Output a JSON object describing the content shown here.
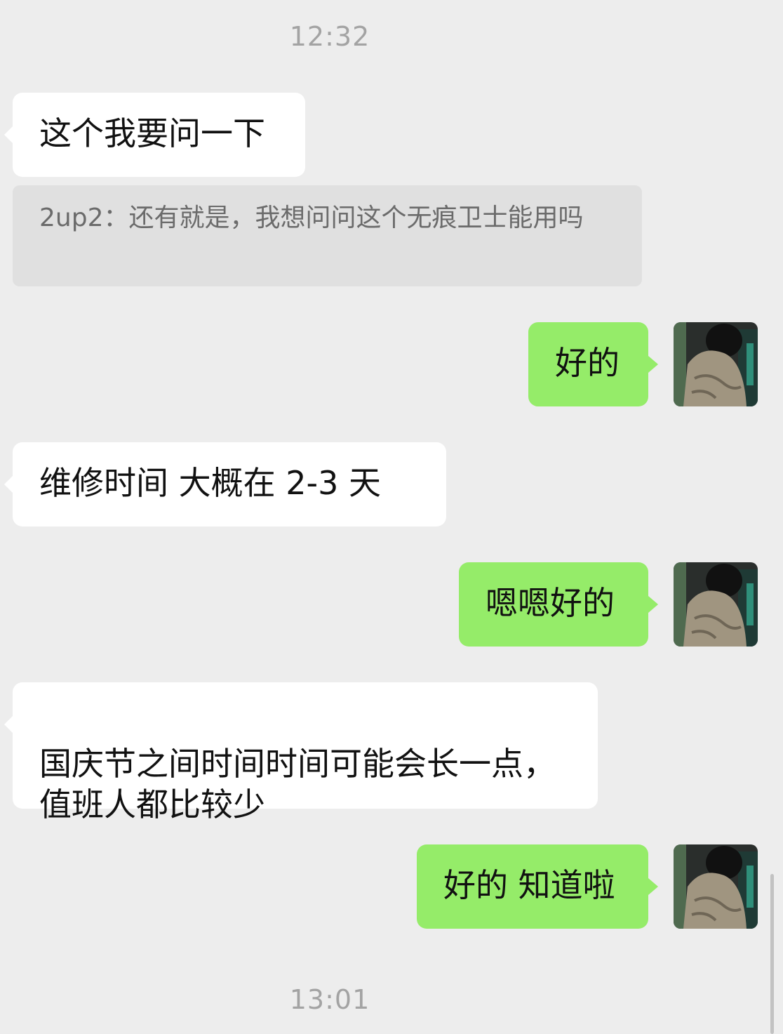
{
  "timestamps": [
    "12:32",
    "13:01"
  ],
  "messages": [
    {
      "side": "left",
      "text": "这个我要问一下"
    },
    {
      "side": "quote",
      "text": "2up2：还有就是，我想问问这个无痕卫士能用吗"
    },
    {
      "side": "right",
      "text": "好的"
    },
    {
      "side": "left",
      "text": "维修时间  大概在 2-3 天"
    },
    {
      "side": "right",
      "text": "嗯嗯好的"
    },
    {
      "side": "left",
      "text": "国庆节之间时间时间可能会长一点，\n值班人都比较少"
    },
    {
      "side": "right",
      "text": "好的 知道啦"
    }
  ],
  "colors": {
    "background": "#ededed",
    "incoming_bubble": "#ffffff",
    "outgoing_bubble": "#95ec69",
    "quote_bubble": "#e0e0e0",
    "timestamp": "#a3a3a3"
  },
  "icons": {
    "avatar": "user-avatar-photo"
  }
}
